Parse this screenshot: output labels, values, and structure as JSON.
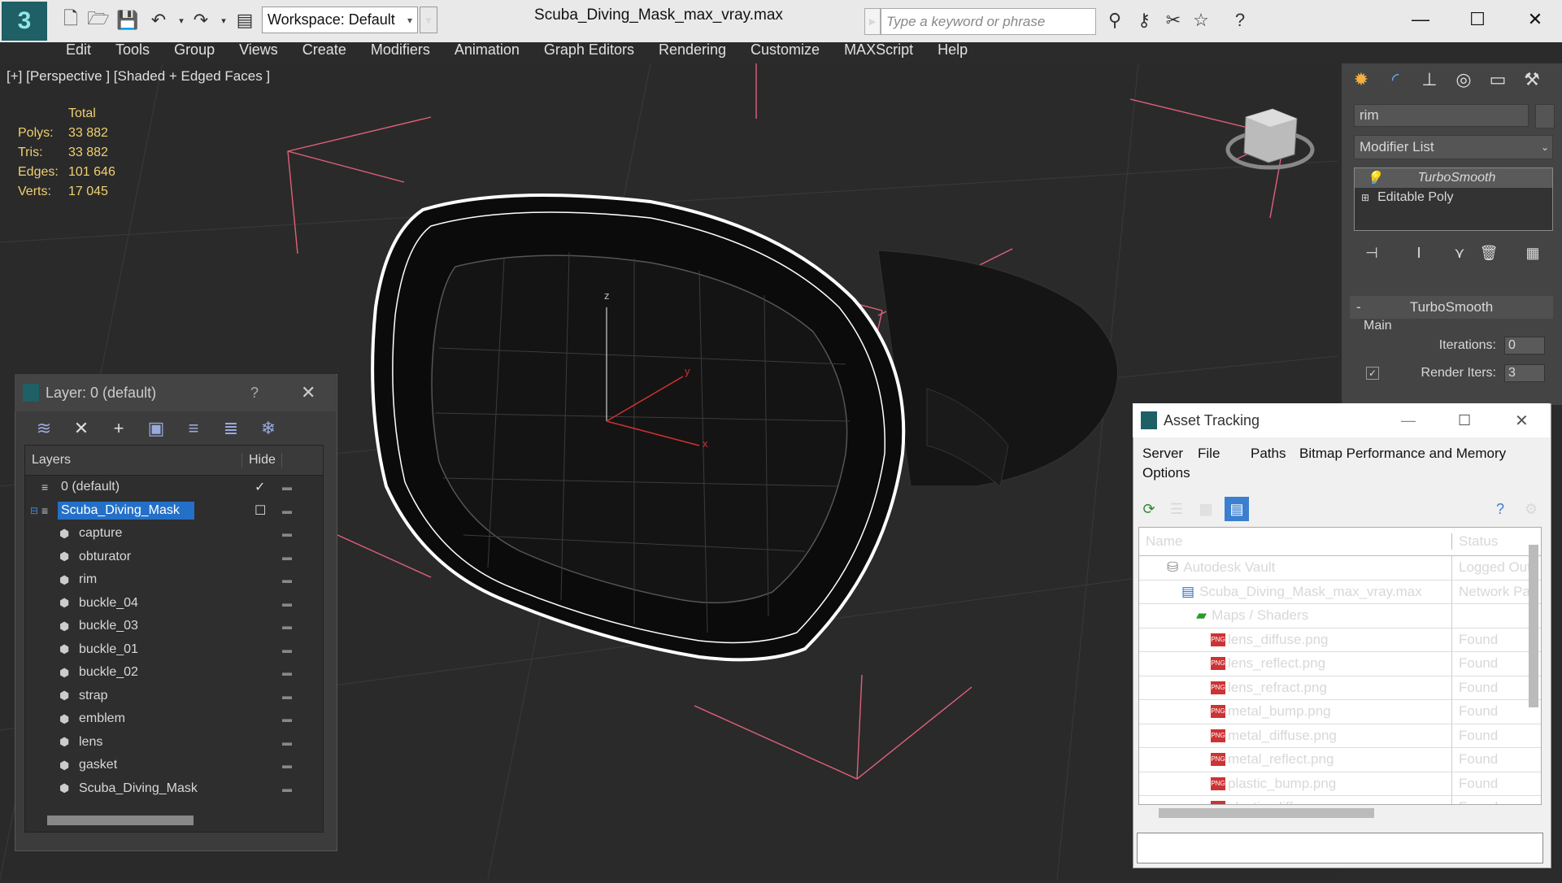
{
  "titlebar": {
    "workspace": "Workspace: Default",
    "doc_title": "Scuba_Diving_Mask_max_vray.max",
    "search_placeholder": "Type a keyword or phrase"
  },
  "menu": [
    "Edit",
    "Tools",
    "Group",
    "Views",
    "Create",
    "Modifiers",
    "Animation",
    "Graph Editors",
    "Rendering",
    "Customize",
    "MAXScript",
    "Help"
  ],
  "viewport": {
    "label": "[+] [Perspective ] [Shaded + Edged Faces ]",
    "stats_header": "Total",
    "stats": [
      {
        "k": "Polys:",
        "v": "33 882"
      },
      {
        "k": "Tris:",
        "v": "33 882"
      },
      {
        "k": "Edges:",
        "v": "101 646"
      },
      {
        "k": "Verts:",
        "v": "17 045"
      }
    ],
    "axis_x": "x",
    "axis_y": "y",
    "axis_z": "z"
  },
  "command_panel": {
    "object_name": "rim",
    "modifier_list": "Modifier List",
    "stack": [
      "TurboSmooth",
      "Editable Poly"
    ],
    "rollout_title": "TurboSmooth",
    "group": "Main",
    "iterations_label": "Iterations:",
    "iterations_value": "0",
    "render_iters_label": "Render Iters:",
    "render_iters_value": "3"
  },
  "layer_panel": {
    "title": "Layer: 0 (default)",
    "help": "?",
    "col_layers": "Layers",
    "col_hide": "Hide",
    "rows": [
      {
        "name": "0 (default)",
        "indent": 1,
        "check": "✓"
      },
      {
        "name": "Scuba_Diving_Mask",
        "indent": 1,
        "check": "☐",
        "selected": true
      },
      {
        "name": "capture",
        "indent": 2
      },
      {
        "name": "obturator",
        "indent": 2
      },
      {
        "name": "rim",
        "indent": 2
      },
      {
        "name": "buckle_04",
        "indent": 2
      },
      {
        "name": "buckle_03",
        "indent": 2
      },
      {
        "name": "buckle_01",
        "indent": 2
      },
      {
        "name": "buckle_02",
        "indent": 2
      },
      {
        "name": "strap",
        "indent": 2
      },
      {
        "name": "emblem",
        "indent": 2
      },
      {
        "name": "lens",
        "indent": 2
      },
      {
        "name": "gasket",
        "indent": 2
      },
      {
        "name": "Scuba_Diving_Mask",
        "indent": 2
      }
    ]
  },
  "asset_panel": {
    "title": "Asset Tracking",
    "menu": [
      "Server",
      "File",
      "Paths",
      "Bitmap Performance and Memory",
      "Options"
    ],
    "col_name": "Name",
    "col_status": "Status",
    "rows": [
      {
        "name": "Autodesk Vault",
        "status": "Logged Out",
        "level": 1,
        "icon": "vault"
      },
      {
        "name": "Scuba_Diving_Mask_max_vray.max",
        "status": "Network Pat",
        "level": 2,
        "icon": "max"
      },
      {
        "name": "Maps / Shaders",
        "status": "",
        "level": 3,
        "icon": "maps"
      },
      {
        "name": "lens_diffuse.png",
        "status": "Found",
        "level": 4,
        "icon": "png"
      },
      {
        "name": "lens_reflect.png",
        "status": "Found",
        "level": 4,
        "icon": "png"
      },
      {
        "name": "lens_refract.png",
        "status": "Found",
        "level": 4,
        "icon": "png"
      },
      {
        "name": "metal_bump.png",
        "status": "Found",
        "level": 4,
        "icon": "png"
      },
      {
        "name": "metal_diffuse.png",
        "status": "Found",
        "level": 4,
        "icon": "png"
      },
      {
        "name": "metal_reflect.png",
        "status": "Found",
        "level": 4,
        "icon": "png"
      },
      {
        "name": "plastic_bump.png",
        "status": "Found",
        "level": 4,
        "icon": "png"
      },
      {
        "name": "plastic_diffuse.png",
        "status": "Found",
        "level": 4,
        "icon": "png"
      }
    ]
  }
}
